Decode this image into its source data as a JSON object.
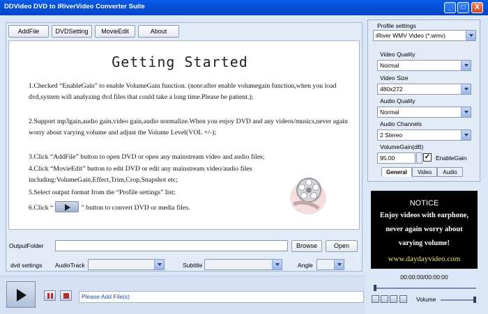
{
  "window": {
    "title": "DDVideo DVD to iRiverVideo Converter Suite",
    "controls": [
      "_",
      "□",
      "X"
    ]
  },
  "toolbar": {
    "add_file": "AddFile",
    "dvd_setting": "DVDSetting",
    "movie_edit": "MovieEdit",
    "about": "About"
  },
  "guide": {
    "title": "Getting Started",
    "steps": [
      "1.Checked “EnableGain” to enable VolumeGain function. (note:after enable volumegain function,when you load dvd,system will analyzing dvd files that could take a long time.Please be patient.);",
      "2.Support mp3gain,audio gain,video gain,audio normalize.When you enjoy DVD and any videos/musics,never again worry about varying volume and adjust the Volume Level(VOL +/-);",
      "3.Click “AddFile” button to open DVD or open any mainstream video and audio files;",
      "4.Click “MovieEdit” button to edit DVD or edit any mainstream video/audio files including:VolumeGain,Effect,Trim,Crop,Snapshot etc;",
      "5.Select output format from the “Profile settings” list;"
    ],
    "step6_before": "6.Click “",
    "step6_after": "” button to convert DVD or media files."
  },
  "output": {
    "label": "OutputFolder",
    "value": "",
    "browse": "Browse",
    "open": "Open"
  },
  "dvd_settings": {
    "label": "dvd settings",
    "audio_track_label": "AudioTrack",
    "audio_track_value": "",
    "subtitle_label": "Subtitle",
    "subtitle_value": "",
    "angle_label": "Angle",
    "angle_value": ""
  },
  "status": {
    "text": "Please Add File(s)"
  },
  "profile": {
    "label": "Profile settings",
    "selected": "iRiver WMV Video (*.wmv)",
    "video_quality_label": "Video Quality",
    "video_quality": "Normal",
    "video_size_label": "Video Size",
    "video_size": "480x272",
    "audio_quality_label": "Audio Quality",
    "audio_quality": "Normal",
    "audio_channels_label": "Audio Channels",
    "audio_channels": "2 Stereo",
    "volume_gain_label": "VolumeGain(dB)",
    "volume_gain": "95.00",
    "enable_gain_label": "EnableGain",
    "enable_gain_checked": true,
    "tabs": [
      "General",
      "Video",
      "Audio"
    ]
  },
  "notice": {
    "title": "NOTICE",
    "lines": [
      "Enjoy videos with earphone,",
      "never again worry about",
      "varying volume!"
    ],
    "url": "www.daydayvideo.com"
  },
  "player": {
    "timecode": "00:00:00/00:00:00",
    "volume_label": "Volume"
  }
}
